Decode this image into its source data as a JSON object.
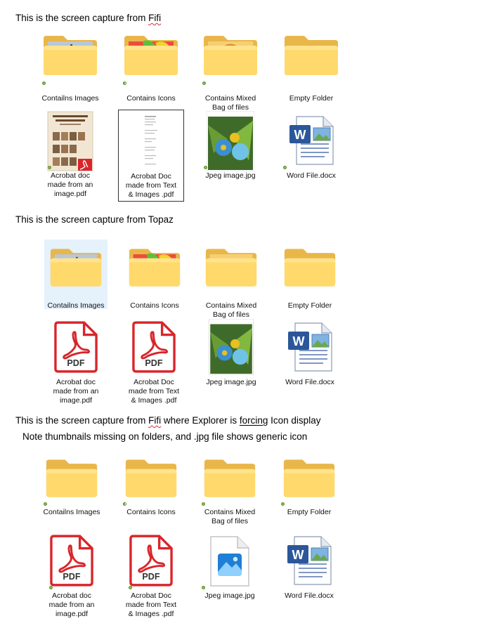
{
  "sections": [
    {
      "title_parts": [
        "This is the screen capture from ",
        "Fifi"
      ],
      "items": [
        {
          "label": "Contailns Images",
          "icon": "folder-with-images-thumbnail-icon"
        },
        {
          "label": "Contains Icons",
          "icon": "folder-with-icons-thumbnail-icon"
        },
        {
          "label": "Contains Mixed\nBag of files",
          "icon": "folder-with-mixed-thumbnail-icon"
        },
        {
          "label": "Empty Folder",
          "icon": "empty-folder-icon"
        },
        {
          "label": "Acrobat doc\nmade from an\nimage.pdf",
          "icon": "pdf-thumbnail-icon"
        },
        {
          "label": "Acrobat Doc\nmade from Text\n& Images .pdf",
          "icon": "pdf-text-thumbnail-icon"
        },
        {
          "label": "Jpeg image.jpg",
          "icon": "jpeg-thumbnail-icon"
        },
        {
          "label": "Word File.docx",
          "icon": "word-document-icon"
        }
      ]
    },
    {
      "title_parts": [
        "This is the screen capture from Topaz"
      ],
      "items": [
        {
          "label": "Contailns Images",
          "icon": "folder-with-images-thumbnail-icon"
        },
        {
          "label": "Contains Icons",
          "icon": "folder-with-icons-thumbnail-icon"
        },
        {
          "label": "Contains Mixed\nBag of files",
          "icon": "folder-with-bird-thumbnail-icon"
        },
        {
          "label": "Empty Folder",
          "icon": "empty-folder-icon"
        },
        {
          "label": "Acrobat doc\nmade from an\nimage.pdf",
          "icon": "pdf-icon"
        },
        {
          "label": "Acrobat Doc\nmade from Text\n& Images .pdf",
          "icon": "pdf-icon"
        },
        {
          "label": "Jpeg image.jpg",
          "icon": "jpeg-thumbnail-icon"
        },
        {
          "label": "Word File.docx",
          "icon": "word-document-icon"
        }
      ]
    },
    {
      "title_parts": [
        "This is the screen capture from ",
        "Fifi",
        " where Explorer is ",
        "forcing",
        " Icon display"
      ],
      "subtitle": "Note thumbnails missing on folders, and .jpg file shows  generic icon",
      "items": [
        {
          "label": "Contailns Images",
          "icon": "plain-folder-icon"
        },
        {
          "label": "Contains Icons",
          "icon": "plain-folder-icon"
        },
        {
          "label": "Contains Mixed\nBag of files",
          "icon": "plain-folder-icon"
        },
        {
          "label": "Empty Folder",
          "icon": "plain-folder-icon"
        },
        {
          "label": "Acrobat doc\nmade from an\nimage.pdf",
          "icon": "pdf-icon"
        },
        {
          "label": "Acrobat Doc\nmade from Text\n& Images .pdf",
          "icon": "pdf-icon"
        },
        {
          "label": "Jpeg image.jpg",
          "icon": "generic-image-file-icon"
        },
        {
          "label": "Word File.docx",
          "icon": "word-document-icon"
        }
      ]
    }
  ],
  "pdf_badge_text": "PDF",
  "word_badge_text": "W",
  "colors": {
    "folder_back": "#f3c35a",
    "folder_front": "#ffd96b",
    "pdf_red": "#d8262b",
    "word_blue": "#2b579a"
  }
}
